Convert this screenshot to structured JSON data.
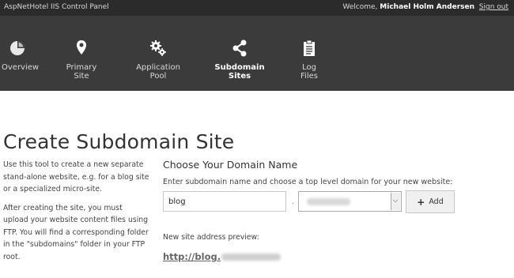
{
  "header": {
    "app_title": "AspNetHotel IIS Control Panel",
    "welcome_prefix": "Welcome, ",
    "user_name": "Michael Holm Andersen",
    "sign_out": "Sign out"
  },
  "nav": {
    "items": [
      {
        "label": "Overview",
        "icon": "pie-chart-icon"
      },
      {
        "label": "Primary Site",
        "icon": "map-pin-icon"
      },
      {
        "label": "Application Pool",
        "icon": "gears-icon"
      },
      {
        "label": "Subdomain Sites",
        "icon": "share-icon",
        "active": true
      },
      {
        "label": "Log Files",
        "icon": "clipboard-icon"
      }
    ]
  },
  "page": {
    "title": "Create Subdomain Site",
    "intro_p1": "Use this tool to create a new separate stand-alone website, e.g. for a blog site or a specialized micro-site.",
    "intro_p2": "After creating the site, you must upload your website content files using FTP. You will find a corresponding folder in the \"subdomains\" folder in your FTP root."
  },
  "form": {
    "section_title": "Choose Your Domain Name",
    "instructions": "Enter subdomain name and choose a top level domain for your new website:",
    "subdomain_value": "blog",
    "separator": ".",
    "add_label": "Add",
    "preview_label": "New site address preview:",
    "preview_prefix": "http://blog."
  },
  "colors": {
    "topbar_bg": "#2b2b2b",
    "nav_bg": "#3b3b3b",
    "page_bg": "#ffffff"
  }
}
